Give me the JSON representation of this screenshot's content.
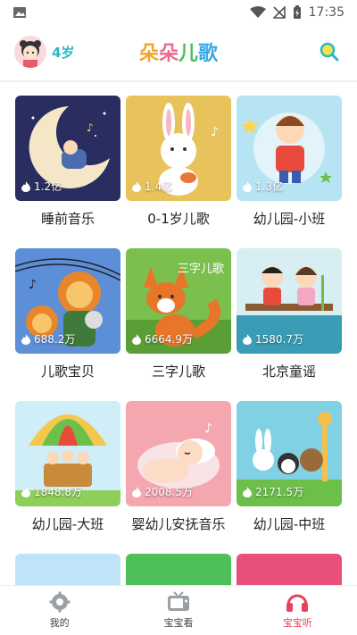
{
  "status": {
    "time": "17:35"
  },
  "header": {
    "age": "4岁",
    "brand": [
      "朵",
      "朵",
      "儿",
      "歌"
    ]
  },
  "colors": {
    "accent": "#25b9c9",
    "active_tab": "#e8405e"
  },
  "cards": [
    {
      "title": "睡前音乐",
      "plays": "1.2亿"
    },
    {
      "title": "0-1岁儿歌",
      "plays": "1.4亿"
    },
    {
      "title": "幼儿园-小班",
      "plays": "1.3亿"
    },
    {
      "title": "儿歌宝贝",
      "plays": "688.2万"
    },
    {
      "title": "三字儿歌",
      "plays": "6664.9万",
      "thumb_text": "三字儿歌"
    },
    {
      "title": "北京童谣",
      "plays": "1580.7万"
    },
    {
      "title": "幼儿园-大班",
      "plays": "1848.8万"
    },
    {
      "title": "婴幼儿安抚音乐",
      "plays": "2008.5万"
    },
    {
      "title": "幼儿园-中班",
      "plays": "2171.5万"
    }
  ],
  "tabs": [
    {
      "label": "我的",
      "icon": "gear-icon"
    },
    {
      "label": "宝宝看",
      "icon": "tv-icon"
    },
    {
      "label": "宝宝听",
      "icon": "headphones-icon",
      "active": true
    }
  ]
}
